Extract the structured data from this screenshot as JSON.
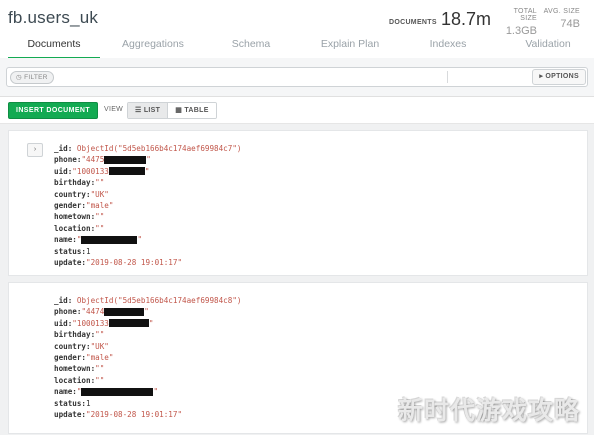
{
  "header": {
    "namespace": "fb.users_uk",
    "documents_label": "DOCUMENTS",
    "documents_value": "18.7m",
    "total_size_label": "TOTAL SIZE",
    "total_size_value": "1.3GB",
    "avg_size_label": "AVG. SIZE",
    "avg_size_value": "74B"
  },
  "tabs": [
    {
      "label": "Documents",
      "active": true
    },
    {
      "label": "Aggregations",
      "active": false
    },
    {
      "label": "Schema",
      "active": false
    },
    {
      "label": "Explain Plan",
      "active": false
    },
    {
      "label": "Indexes",
      "active": false
    },
    {
      "label": "Validation",
      "active": false
    }
  ],
  "filter": {
    "pill_label": "FILTER",
    "pill_icon": "clock-icon",
    "options_label": "OPTIONS",
    "options_icon": "triangle-right-icon"
  },
  "toolbar": {
    "insert_label": "INSERT DOCUMENT",
    "view_label": "VIEW",
    "list_label": "LIST",
    "table_label": "TABLE",
    "active_view": "LIST"
  },
  "documents": [
    {
      "id": "ObjectId(\"5d5eb166b4c174aef69984c7\")",
      "phone": "\"4475",
      "uid": "\"1000133",
      "birthday": "\"\"",
      "country": "\"UK\"",
      "gender": "\"male\"",
      "hometown": "\"\"",
      "location": "\"\"",
      "name": "\"",
      "status": "1",
      "update": "\"2019-08-28 19:01:17\""
    },
    {
      "id": "ObjectId(\"5d5eb166b4c174aef69984c8\")",
      "phone": "\"4474",
      "uid": "\"1000133",
      "birthday": "\"\"",
      "country": "\"UK\"",
      "gender": "\"male\"",
      "hometown": "\"\"",
      "location": "\"\"",
      "name": "\"",
      "status": "1",
      "update": "\"2019-08-28 19:01:17\""
    }
  ],
  "field_keys": {
    "id": "_id:",
    "phone": "phone:",
    "uid": "uid:",
    "birthday": "birthday:",
    "country": "country:",
    "gender": "gender:",
    "hometown": "hometown:",
    "location": "location:",
    "name": "name:",
    "status": "status:",
    "update": "update:"
  },
  "closing_quote": "\"",
  "watermark": "新时代游戏攻略",
  "colors": {
    "accent_green": "#13aa52",
    "string_value": "#c1564a"
  }
}
